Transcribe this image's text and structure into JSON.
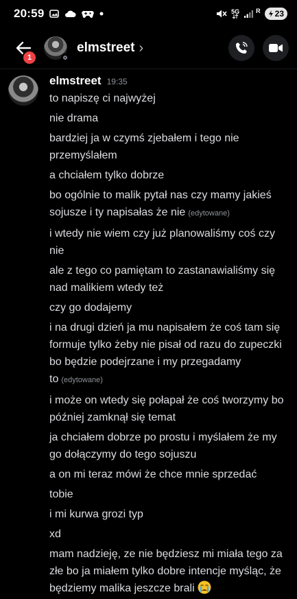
{
  "status_bar": {
    "time": "20:59",
    "battery": "23",
    "icons": [
      "image-icon",
      "cloud-icon",
      "game-controller-icon",
      "dot-icon",
      "mute-icon",
      "signal-5g-icon",
      "signal-bars-icon"
    ],
    "network_label": "5G",
    "roaming_label": "R"
  },
  "header": {
    "back_badge": "1",
    "username": "elmstreet",
    "chevron": "›"
  },
  "message": {
    "author": "elmstreet",
    "time": "19:35",
    "edited_label": "(edytowane)",
    "lines": [
      "to napiszę ci najwyżej",
      "nie drama",
      "bardziej ja w czymś zjebałem i tego nie przemyślałem",
      "a chciałem tylko dobrze",
      "bo ogólnie to malik pytał nas czy mamy jakieś sojusze i ty napisałas że nie",
      "i wtedy nie wiem czy już planowaliśmy coś czy nie",
      "ale z tego co pamiętam to zastanawialiśmy się nad malikiem wtedy też",
      "czy go dodajemy",
      "i na drugi dzień ja mu napisałem że coś tam się formuje tylko żeby nie pisał od razu do zupeczki bo będzie podejrzane i my przegadamy to",
      "i może on wtedy się połapał że coś tworzymy bo później zamknął się temat",
      "ja chciałem dobrze po prostu i myślałem że my go dołączymy do tego sojuszu",
      "a on mi teraz mówi że chce mnie sprzedać",
      "tobie",
      "i mi kurwa grozi typ",
      "xd",
      "mam nadzieję, ze nie będziesz mi miała tego za złe bo ja miałem tylko dobre intencje myśląc, że będziemy malika jeszcze brali"
    ],
    "edited_line_indices": [
      4,
      8
    ],
    "last_line_emoji": "crying-face-emoji"
  },
  "colors": {
    "background": "#000000",
    "text": "#dcdde1",
    "muted": "#8e9297",
    "badge": "#ed4245",
    "button_bg": "#1e1f22"
  }
}
